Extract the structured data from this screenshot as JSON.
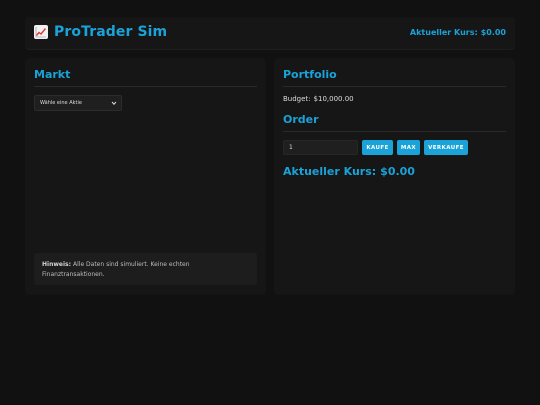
{
  "header": {
    "title": "ProTrader Sim",
    "price_label": "Aktueller Kurs:",
    "price_value": "$0.00"
  },
  "market": {
    "title": "Markt",
    "select_value": "Wähle eine Aktie",
    "notice_label": "Hinweis:",
    "notice_text": "Alle Daten sind simuliert. Keine echten Finanztransaktionen."
  },
  "portfolio": {
    "title": "Portfolio",
    "budget_label": "Budget:",
    "budget_value": "$10,000.00"
  },
  "order": {
    "title": "Order",
    "quantity_value": "1",
    "buy_label": "KAUFE",
    "max_label": "MAX",
    "sell_label": "VERKAUFE",
    "price_label": "Aktueller Kurs:",
    "price_value": "$0.00"
  },
  "colors": {
    "accent": "#1aa3d9",
    "background": "#111111",
    "panel": "#161616"
  },
  "icons": {
    "logo": "chart-increasing-icon",
    "select": "chevron-down-icon"
  }
}
